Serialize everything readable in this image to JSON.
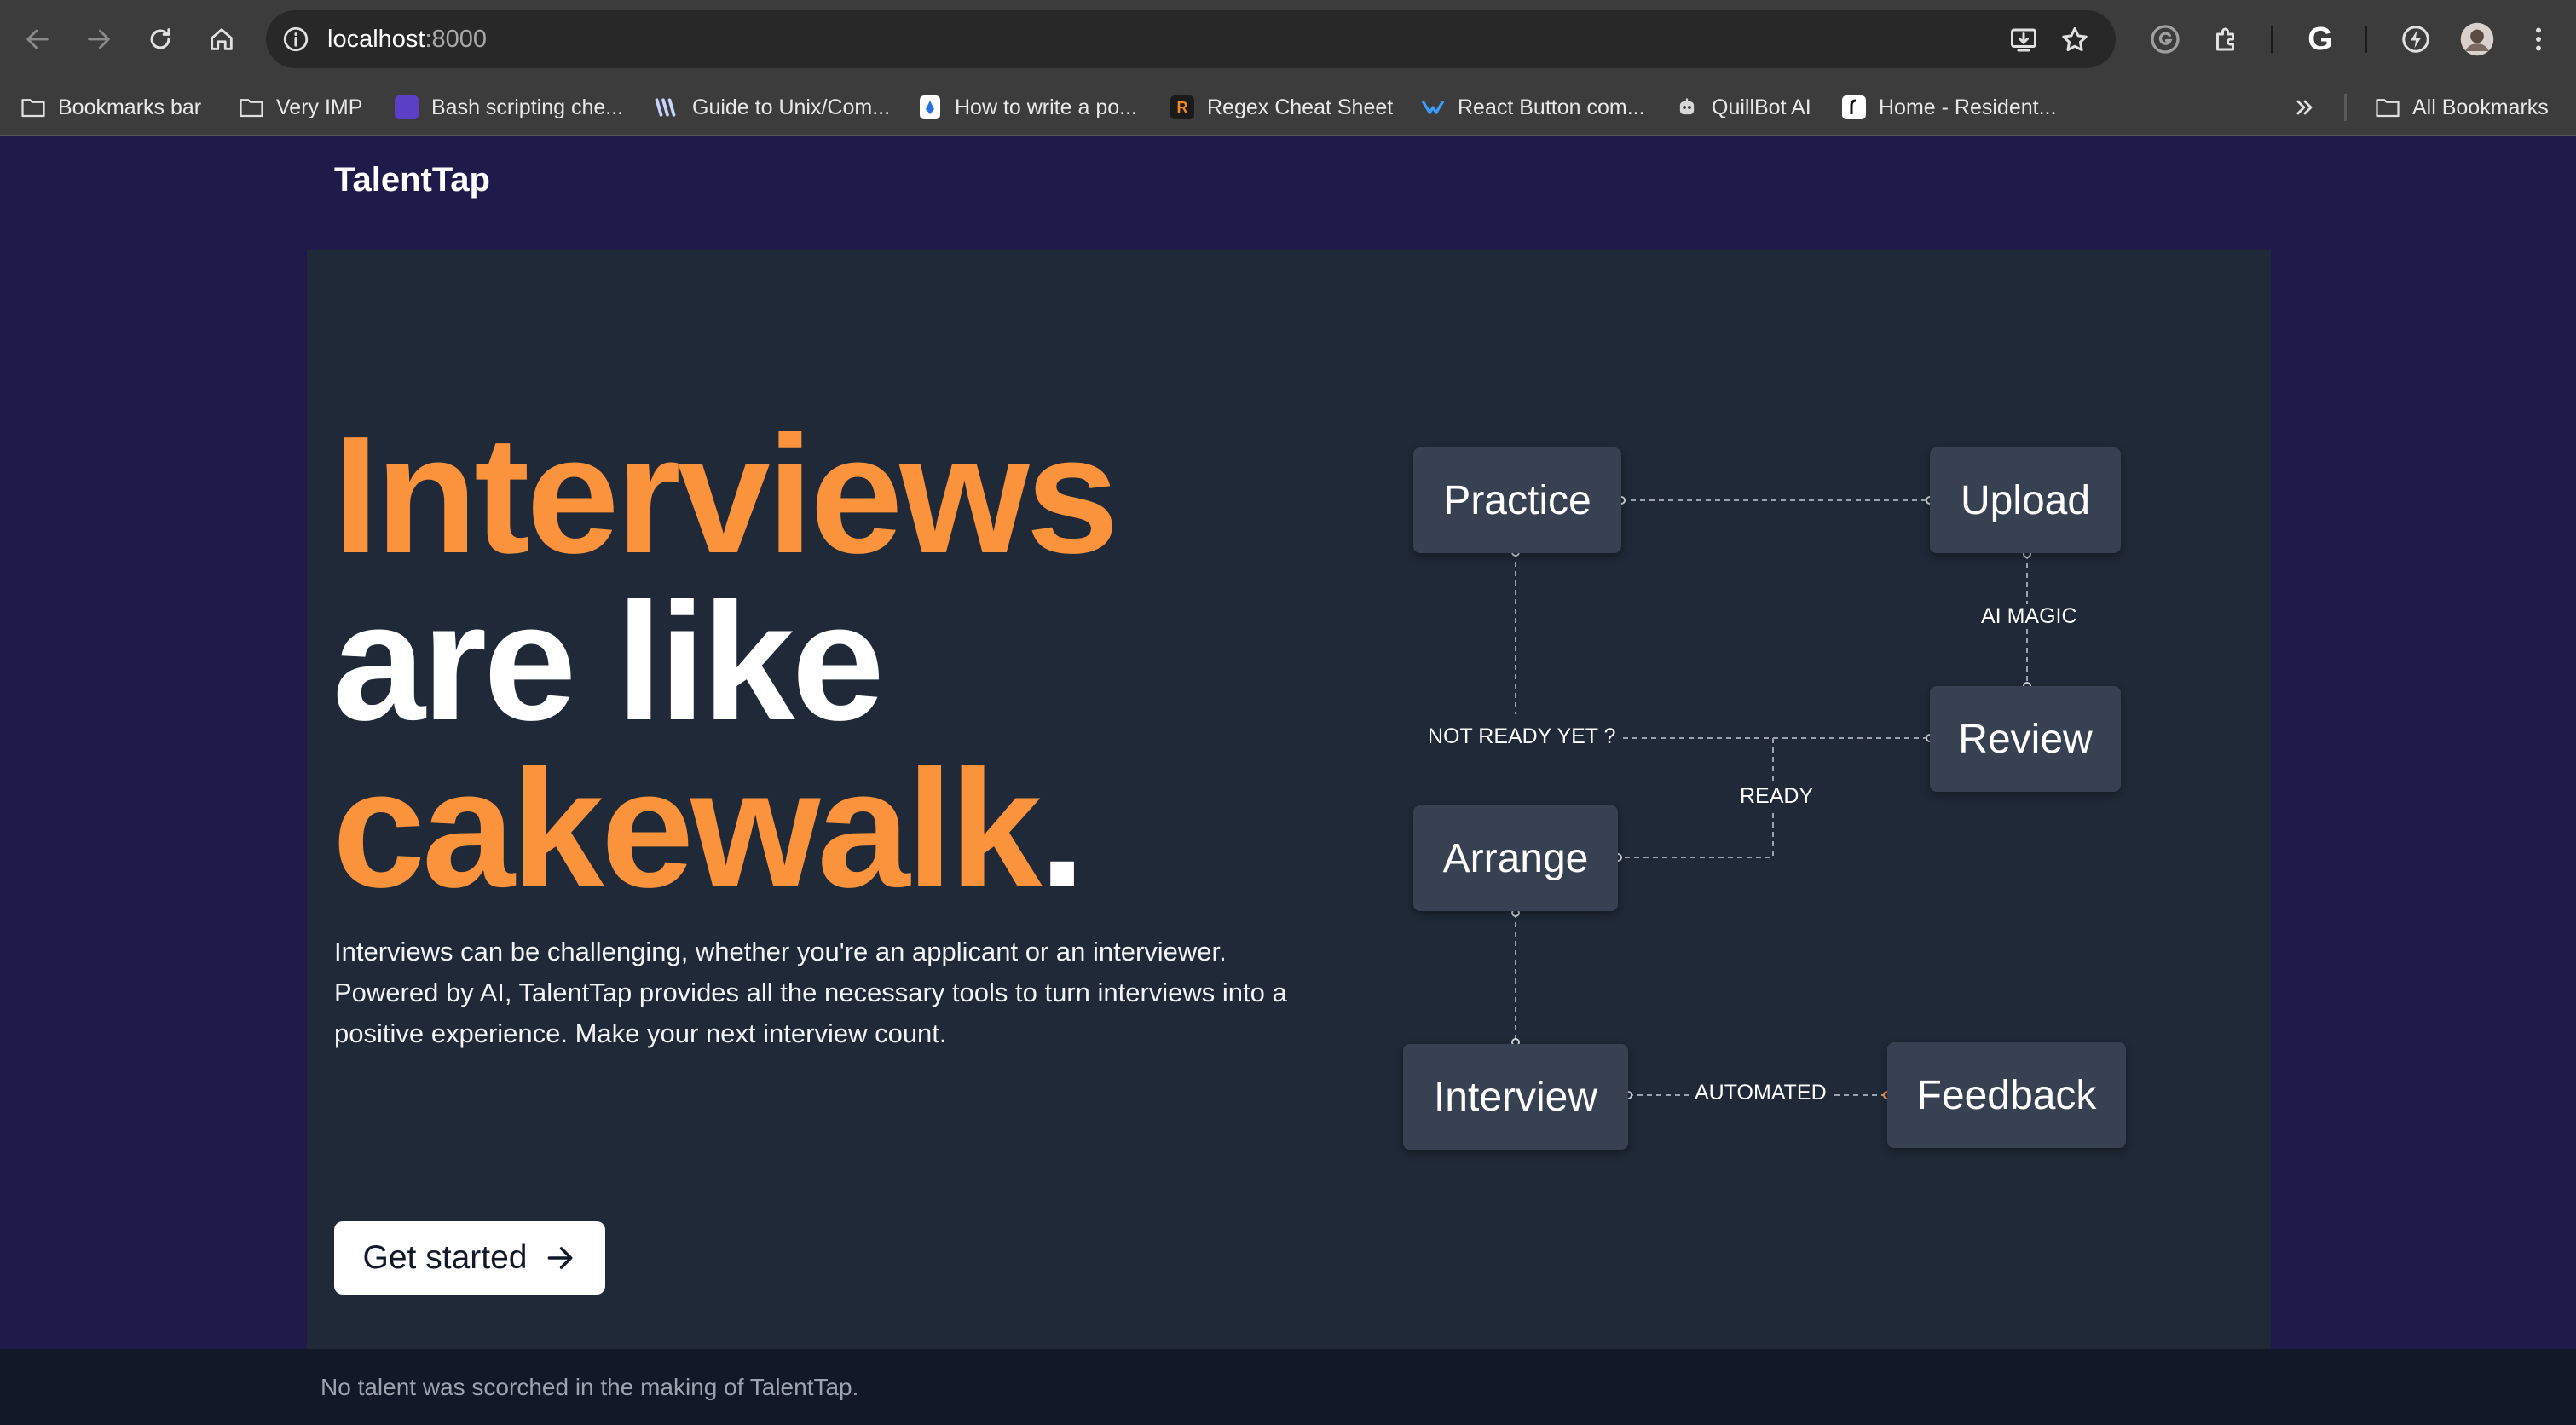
{
  "browser": {
    "url_host": "localhost",
    "url_port": ":8000",
    "bookmarks": [
      {
        "label": "Bookmarks bar",
        "icon": "folder-icon"
      },
      {
        "label": "Very IMP",
        "icon": "folder-icon"
      },
      {
        "label": "Bash scripting che...",
        "icon": "bash-favicon"
      },
      {
        "label": "Guide to Unix/Com...",
        "icon": "unix-favicon"
      },
      {
        "label": "How to write a po...",
        "icon": "doc-favicon"
      },
      {
        "label": "Regex Cheat Sheet",
        "icon": "regex-favicon",
        "glyph": "R"
      },
      {
        "label": "React Button com...",
        "icon": "react-favicon"
      },
      {
        "label": "QuillBot AI",
        "icon": "quillbot-favicon"
      },
      {
        "label": "Home - Resident...",
        "icon": "resident-favicon"
      }
    ],
    "all_bookmarks": "All Bookmarks",
    "extension_g": "G"
  },
  "page": {
    "brand": "TalentTap",
    "headline": {
      "line1": "Interviews",
      "line2": "are like",
      "line3": "cakewalk",
      "period": "."
    },
    "description": "Interviews can be challenging, whether you're an applicant or an interviewer. Powered by AI, TalentTap provides all the necessary tools to turn interviews into a positive experience. Make your next interview count.",
    "cta_label": "Get started",
    "footer": "No talent was scorched in the making of TalentTap."
  },
  "diagram": {
    "nodes": {
      "practice": "Practice",
      "upload": "Upload",
      "review": "Review",
      "arrange": "Arrange",
      "interview": "Interview",
      "feedback": "Feedback"
    },
    "labels": {
      "ai_magic": "AI MAGIC",
      "not_ready": "NOT READY YET ?",
      "ready": "READY",
      "automated": "AUTOMATED"
    }
  },
  "colors": {
    "page_bg": "#1e1b4b",
    "hero_bg": "#1f2937",
    "accent": "#fb923c",
    "node_bg": "#374151",
    "footer_bg": "#111827"
  }
}
